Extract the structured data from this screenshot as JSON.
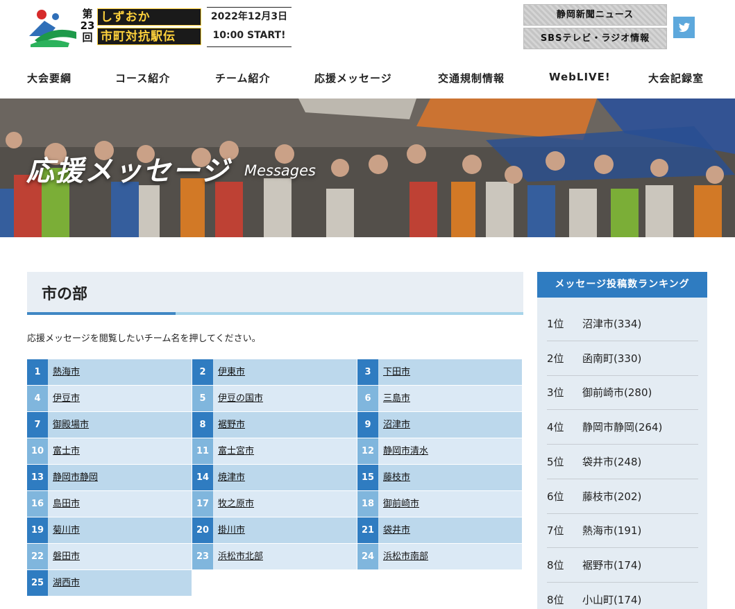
{
  "header": {
    "edition": [
      "第",
      "23",
      "回"
    ],
    "title_line1": "しずおか",
    "title_line2": "市町対抗駅伝",
    "date": "2022年12月3日",
    "start": "10:00 START!",
    "news_links": [
      "静岡新聞ニュース",
      "SBSテレビ・ラジオ情報"
    ],
    "twitter_icon": "twitter-icon"
  },
  "nav": [
    "大会要綱",
    "コース紹介",
    "チーム紹介",
    "応援メッセージ",
    "交通規制情報",
    "WebLIVE!",
    "大会記録室"
  ],
  "hero": {
    "title": "応援メッセージ",
    "subtitle": "Messages"
  },
  "section": {
    "title": "市の部",
    "intro": "応援メッセージを閲覧したいチーム名を押してください。"
  },
  "teams": [
    {
      "num": "1",
      "name": "熱海市"
    },
    {
      "num": "2",
      "name": "伊東市"
    },
    {
      "num": "3",
      "name": "下田市"
    },
    {
      "num": "4",
      "name": "伊豆市"
    },
    {
      "num": "5",
      "name": "伊豆の国市"
    },
    {
      "num": "6",
      "name": "三島市"
    },
    {
      "num": "7",
      "name": "御殿場市"
    },
    {
      "num": "8",
      "name": "裾野市"
    },
    {
      "num": "9",
      "name": "沼津市"
    },
    {
      "num": "10",
      "name": "富士市"
    },
    {
      "num": "11",
      "name": "富士宮市"
    },
    {
      "num": "12",
      "name": "静岡市清水"
    },
    {
      "num": "13",
      "name": "静岡市静岡"
    },
    {
      "num": "14",
      "name": "焼津市"
    },
    {
      "num": "15",
      "name": "藤枝市"
    },
    {
      "num": "16",
      "name": "島田市"
    },
    {
      "num": "17",
      "name": "牧之原市"
    },
    {
      "num": "18",
      "name": "御前崎市"
    },
    {
      "num": "19",
      "name": "菊川市"
    },
    {
      "num": "20",
      "name": "掛川市"
    },
    {
      "num": "21",
      "name": "袋井市"
    },
    {
      "num": "22",
      "name": "磐田市"
    },
    {
      "num": "23",
      "name": "浜松市北部"
    },
    {
      "num": "24",
      "name": "浜松市南部"
    },
    {
      "num": "25",
      "name": "湖西市"
    }
  ],
  "ranking": {
    "title": "メッセージ投稿数ランキング",
    "items": [
      {
        "rank": "1位",
        "team": "沼津市(334)"
      },
      {
        "rank": "2位",
        "team": "函南町(330)"
      },
      {
        "rank": "3位",
        "team": "御前崎市(280)"
      },
      {
        "rank": "4位",
        "team": "静岡市静岡(264)"
      },
      {
        "rank": "5位",
        "team": "袋井市(248)"
      },
      {
        "rank": "6位",
        "team": "藤枝市(202)"
      },
      {
        "rank": "7位",
        "team": "熱海市(191)"
      },
      {
        "rank": "8位",
        "team": "裾野市(174)"
      },
      {
        "rank": "8位",
        "team": "小山町(174)"
      }
    ]
  }
}
